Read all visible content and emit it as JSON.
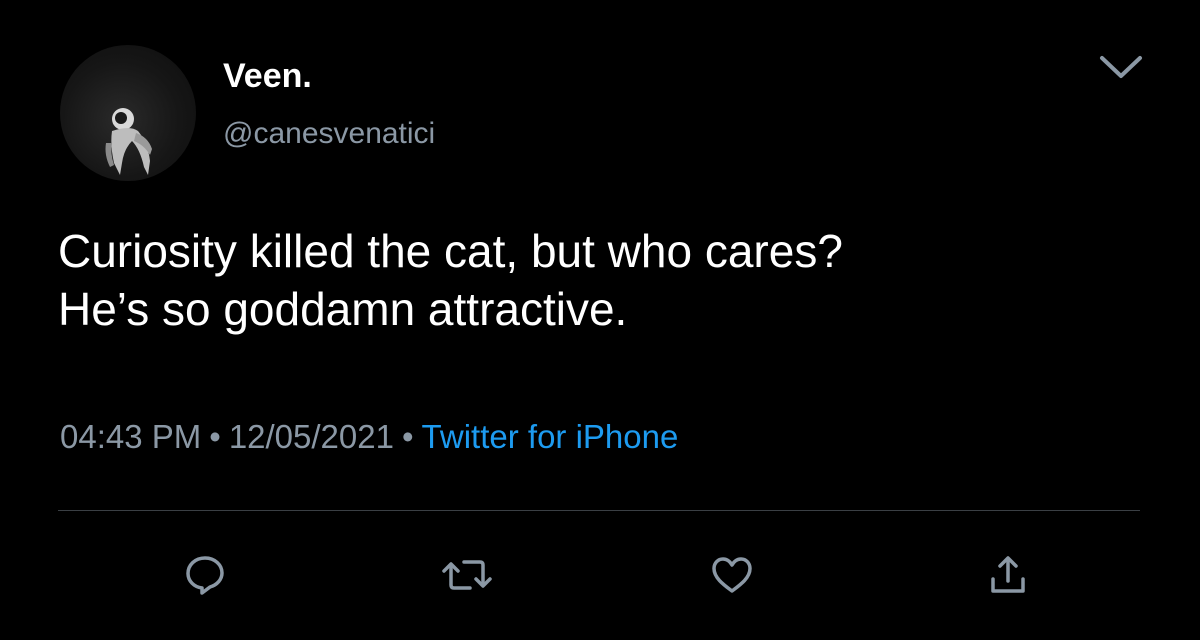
{
  "tweet": {
    "display_name": "Veen.",
    "handle": "@canesvenatici",
    "text_lines": [
      "Curiosity killed the cat, but who cares?",
      "He’s so goddamn attractive."
    ],
    "time": "04:43 PM",
    "date": "12/05/2021",
    "source": "Twitter for iPhone",
    "separator": "•"
  },
  "icons": {
    "avatar": "astronaut-avatar",
    "menu": "chevron-down-icon",
    "reply": "reply-icon",
    "retweet": "retweet-icon",
    "like": "heart-icon",
    "share": "share-icon"
  },
  "colors": {
    "background": "#000000",
    "primary_text": "#ffffff",
    "secondary_text": "#8b98a5",
    "link": "#1d9bf0",
    "divider": "#3a3f44"
  }
}
